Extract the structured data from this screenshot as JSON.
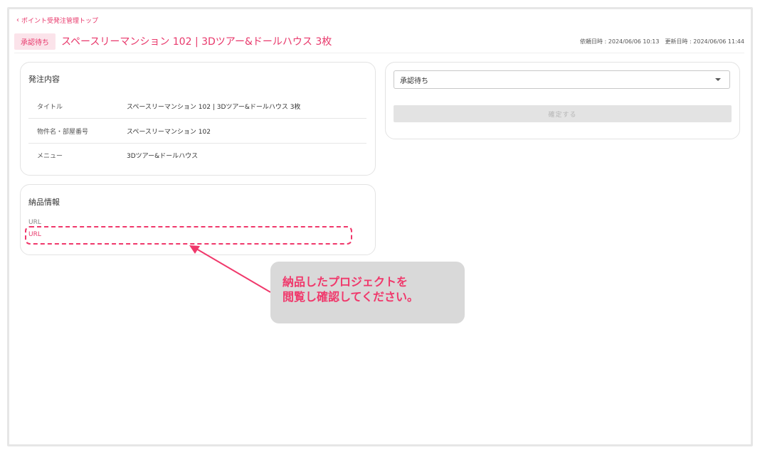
{
  "nav": {
    "back_label": "ポイント受発注管理トップ"
  },
  "header": {
    "status_badge": "承認待ち",
    "title": "スペースリーマンション 102 | 3Dツアー&ドールハウス 3枚",
    "requested_at": "依頼日時 : 2024/06/06 10:13",
    "updated_at": "更新日時 : 2024/06/06 11:44"
  },
  "order_card": {
    "title": "発注内容",
    "rows": [
      {
        "label": "タイトル",
        "value": "スペースリーマンション 102 | 3Dツアー&ドールハウス 3枚"
      },
      {
        "label": "物件名・部屋番号",
        "value": "スペースリーマンション 102"
      },
      {
        "label": "メニュー",
        "value": "3Dツアー&ドールハウス"
      }
    ]
  },
  "delivery_card": {
    "title": "納品情報",
    "url_label": "URL",
    "url_link": "URL"
  },
  "status_card": {
    "selected_status": "承認待ち",
    "confirm_label": "確定する"
  },
  "annotation": {
    "line1": "納品したプロジェクトを",
    "line2": "閲覧し確認してください。"
  },
  "colors": {
    "accent": "#e8386b",
    "annotation": "#f0386b",
    "callout_bg": "#d9d9d9"
  }
}
